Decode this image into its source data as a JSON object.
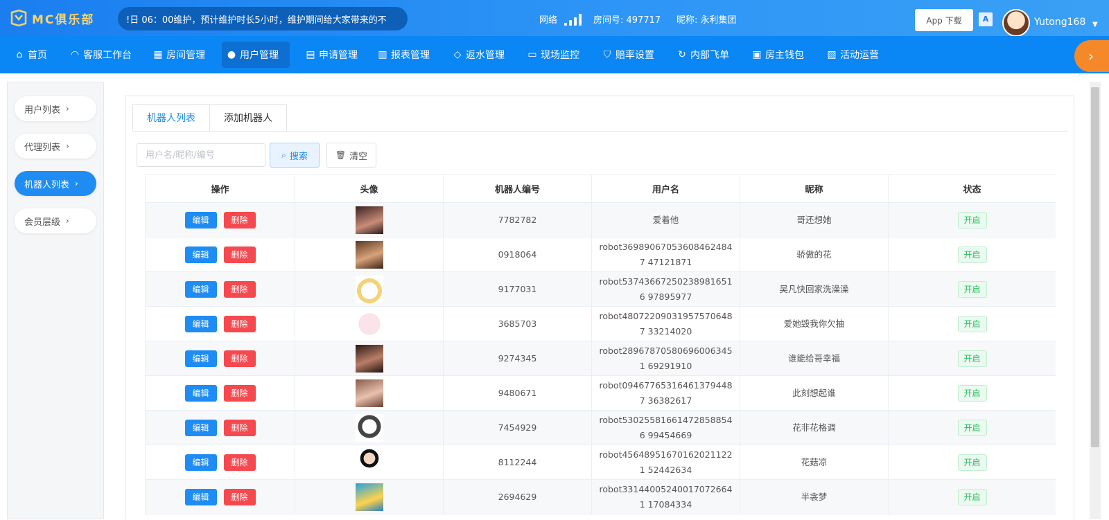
{
  "header": {
    "logo_text": "MC俱乐部",
    "notice": "!日 06：00维护，预计维护时长5小时，维护期间给大家带来的不",
    "network_label": "网络",
    "room_label": "房间号: 497717",
    "nickname_label": "昵称: 永利集团",
    "app_download": "App 下载",
    "translate_glyph": "A",
    "username": "Yutong168"
  },
  "nav": {
    "items": [
      {
        "label": "首页",
        "icon": "home-icon"
      },
      {
        "label": "客服工作台",
        "icon": "headset-icon"
      },
      {
        "label": "房间管理",
        "icon": "grid-icon"
      },
      {
        "label": "用户管理",
        "icon": "user-icon"
      },
      {
        "label": "申请管理",
        "icon": "document-icon"
      },
      {
        "label": "报表管理",
        "icon": "bar-chart-icon"
      },
      {
        "label": "返水管理",
        "icon": "tag-icon"
      },
      {
        "label": "现场监控",
        "icon": "monitor-icon"
      },
      {
        "label": "赔率设置",
        "icon": "shield-icon"
      },
      {
        "label": "内部飞单",
        "icon": "refresh-icon"
      },
      {
        "label": "房主钱包",
        "icon": "wallet-icon"
      },
      {
        "label": "活动运营",
        "icon": "gift-icon"
      }
    ],
    "active_index": 3
  },
  "sidebar": {
    "items": [
      {
        "label": "用户列表"
      },
      {
        "label": "代理列表"
      },
      {
        "label": "机器人列表"
      },
      {
        "label": "会员层级"
      }
    ],
    "active_index": 2
  },
  "tabs": [
    {
      "label": "机器人列表"
    },
    {
      "label": "添加机器人"
    }
  ],
  "search": {
    "placeholder": "用户名/昵称/编号",
    "value": "",
    "search_label": "搜索",
    "clear_label": "清空"
  },
  "table": {
    "columns": [
      "操作",
      "头像",
      "机器人编号",
      "用户名",
      "昵称",
      "状态"
    ],
    "edit_label": "编辑",
    "delete_label": "删除",
    "rows": [
      {
        "robot_no": "7782782",
        "username": "爱着他",
        "nickname": "哥还想她",
        "status": "开启"
      },
      {
        "robot_no": "0918064",
        "username": "robot369890670536084624847 47121871",
        "nickname": "骄傲的花",
        "status": "开启"
      },
      {
        "robot_no": "9177031",
        "username": "robot537436672502389816516 97895977",
        "nickname": "吴凡快回家洗澡澡",
        "status": "开启"
      },
      {
        "robot_no": "3685703",
        "username": "robot480722090319575706487 33214020",
        "nickname": "爱她毁我你欠抽",
        "status": "开启"
      },
      {
        "robot_no": "9274345",
        "username": "robot289678705806960063451 69291910",
        "nickname": "谁能给哥幸福",
        "status": "开启"
      },
      {
        "robot_no": "9480671",
        "username": "robot094677653164613794487 36382617",
        "nickname": "此刻想起谁",
        "status": "开启"
      },
      {
        "robot_no": "7454929",
        "username": "robot530255816614728588546 99454669",
        "nickname": "花非花格调",
        "status": "开启"
      },
      {
        "robot_no": "8112244",
        "username": "robot456489516701620211221 52442634",
        "nickname": "花菇凉",
        "status": "开启"
      },
      {
        "robot_no": "2694629",
        "username": "robot331440052400170726641 17084334",
        "nickname": "半衾梦",
        "status": "开启"
      }
    ]
  },
  "colors": {
    "primary": "#1e8cf3",
    "danger": "#f5494f",
    "success": "#2dbb5c",
    "nav_bg": "#0a86f5",
    "accent_orange": "#f5892a"
  }
}
